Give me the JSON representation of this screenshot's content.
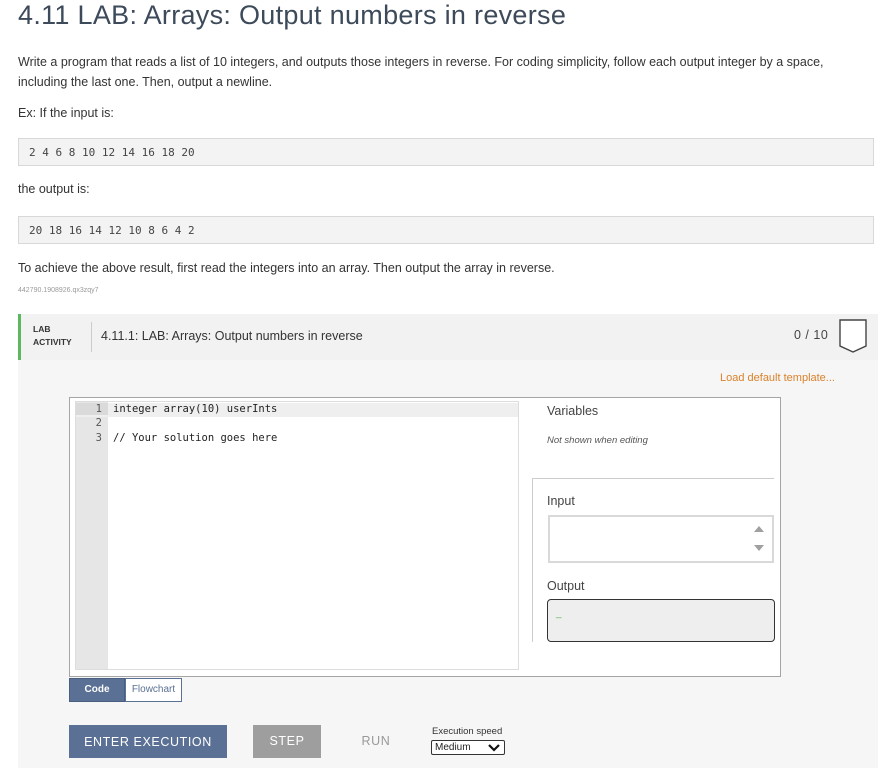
{
  "page": {
    "title": "4.11 LAB: Arrays: Output numbers in reverse",
    "description": "Write a program that reads a list of 10 integers, and outputs those integers in reverse. For coding simplicity, follow each output integer by a space, including the last one. Then, output a newline.",
    "example_intro": "Ex: If the input is:",
    "example_input": "2 4 6 8 10 12 14 16 18 20",
    "output_intro": "the output is:",
    "example_output": "20 18 16 14 12 10 8 6 4 2",
    "hint": "To achieve the above result, first read the integers into an array. Then output the array in reverse.",
    "activity_id": "442790.1908926.qx3zqy7"
  },
  "lab": {
    "tag_line1": "LAB",
    "tag_line2": "ACTIVITY",
    "name": "4.11.1: LAB: Arrays: Output numbers in reverse",
    "score": "0 / 10",
    "load_template_link": "Load default template..."
  },
  "editor": {
    "lines": [
      {
        "num": "1",
        "text": "integer array(10) userInts"
      },
      {
        "num": "2",
        "text": ""
      },
      {
        "num": "3",
        "text": "// Your solution goes here"
      }
    ]
  },
  "panels": {
    "variables_label": "Variables",
    "variables_note": "Not shown when editing",
    "input_label": "Input",
    "input_value": "",
    "output_label": "Output",
    "output_value": "_"
  },
  "tabs": {
    "code": "Code",
    "flowchart": "Flowchart"
  },
  "controls": {
    "enter_execution": "ENTER EXECUTION",
    "step": "STEP",
    "run": "RUN",
    "speed_label": "Execution speed",
    "speed_value": "Medium"
  },
  "colors": {
    "accent": "#5a7094",
    "lab_bar": "#5cb85c",
    "link": "#d9822b",
    "disabled": "#9e9e9e"
  }
}
